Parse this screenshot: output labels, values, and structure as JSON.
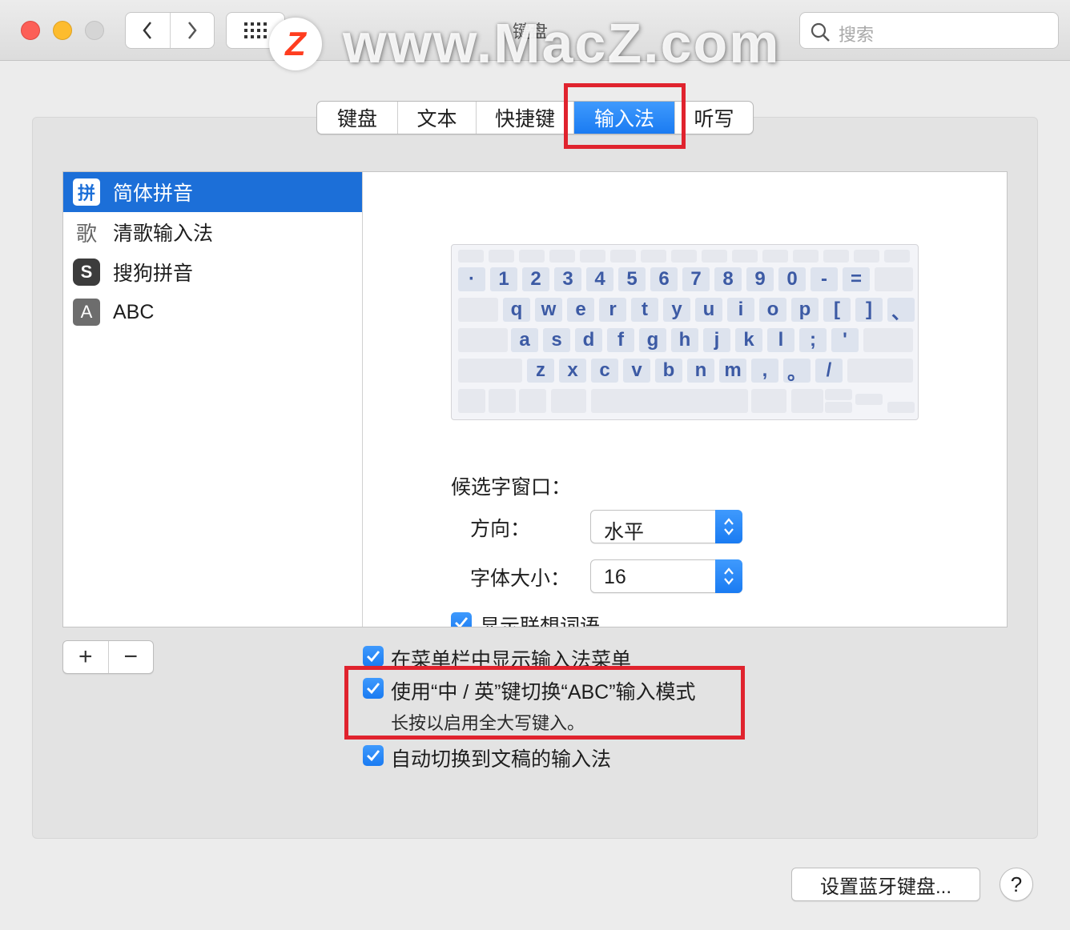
{
  "window": {
    "title": "键盘"
  },
  "search": {
    "placeholder": "搜索"
  },
  "watermark": {
    "logo": "Z",
    "text": "www.MacZ.com"
  },
  "tabs": [
    {
      "label": "键盘",
      "active": false
    },
    {
      "label": "文本",
      "active": false
    },
    {
      "label": "快捷键",
      "active": false
    },
    {
      "label": "输入法",
      "active": true
    },
    {
      "label": "听写",
      "active": false
    }
  ],
  "input_sources": [
    {
      "label": "简体拼音",
      "icon": "pinyin-icon",
      "glyph": "拼",
      "selected": true
    },
    {
      "label": "清歌输入法",
      "icon": "qingge-icon",
      "glyph": "歌",
      "selected": false
    },
    {
      "label": "搜狗拼音",
      "icon": "sogou-icon",
      "glyph": "S",
      "selected": false
    },
    {
      "label": "ABC",
      "icon": "abc-icon",
      "glyph": "A",
      "selected": false
    }
  ],
  "keyboard": {
    "row1": [
      "·",
      "1",
      "2",
      "3",
      "4",
      "5",
      "6",
      "7",
      "8",
      "9",
      "0",
      "-",
      "="
    ],
    "row2": [
      "q",
      "w",
      "e",
      "r",
      "t",
      "y",
      "u",
      "i",
      "o",
      "p",
      "[",
      "]",
      "、"
    ],
    "row3": [
      "a",
      "s",
      "d",
      "f",
      "g",
      "h",
      "j",
      "k",
      "l",
      ";",
      "'"
    ],
    "row4": [
      "z",
      "x",
      "c",
      "v",
      "b",
      "n",
      "m",
      ",",
      "。",
      "/"
    ]
  },
  "candidate": {
    "heading": "候选字窗口：",
    "direction_label": "方向：",
    "direction_value": "水平",
    "font_size_label": "字体大小：",
    "font_size_value": "16",
    "predictive_label": "显示联想词语"
  },
  "controls": {
    "add": "+",
    "remove": "−"
  },
  "options": {
    "show_menu_label": "在菜单栏中显示输入法菜单",
    "caps_switch_label": "使用“中 / 英”键切换“ABC”输入模式",
    "caps_switch_hint": "长按以启用全大写键入。",
    "auto_switch_label": "自动切换到文稿的输入法"
  },
  "footer": {
    "bluetooth_button": "设置蓝牙键盘...",
    "help": "?"
  },
  "colors": {
    "accent": "#1c6fd8",
    "highlight": "#e0232e"
  }
}
